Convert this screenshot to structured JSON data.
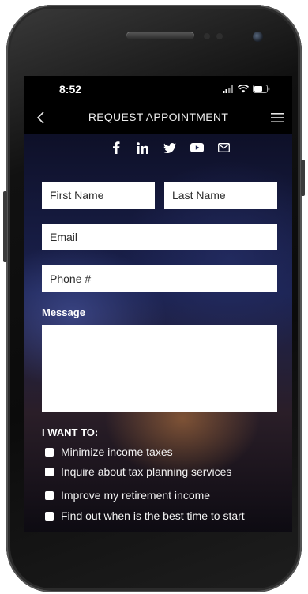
{
  "status_bar": {
    "time": "8:52"
  },
  "header": {
    "title": "REQUEST APPOINTMENT"
  },
  "social_icons": [
    "facebook-icon",
    "linkedin-icon",
    "twitter-icon",
    "youtube-icon",
    "email-icon"
  ],
  "form": {
    "first_name_placeholder": "First Name",
    "last_name_placeholder": "Last Name",
    "email_placeholder": "Email",
    "phone_placeholder": "Phone #",
    "message_label": "Message",
    "message_value": "",
    "i_want_to_label": "I WANT TO:",
    "options": [
      "Minimize income taxes",
      "Inquire about tax planning services",
      "Improve my retirement income",
      "Find out when is the best time to start"
    ]
  },
  "colors": {
    "accent": "#ffffff",
    "header_bg": "#000000"
  }
}
